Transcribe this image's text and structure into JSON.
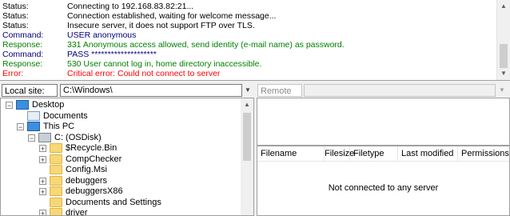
{
  "log": {
    "lines": [
      {
        "type": "Status:",
        "text": "Connecting to 192.168.83.82:21...",
        "color": "#000000"
      },
      {
        "type": "Status:",
        "text": "Connection established, waiting for welcome message...",
        "color": "#000000"
      },
      {
        "type": "Status:",
        "text": "Insecure server, it does not support FTP over TLS.",
        "color": "#000000"
      },
      {
        "type": "Command:",
        "text": "USER anonymous",
        "color": "#000080"
      },
      {
        "type": "Response:",
        "text": "331 Anonymous access allowed, send identity (e-mail name) as password.",
        "color": "#008000"
      },
      {
        "type": "Command:",
        "text": "PASS ********************",
        "color": "#000080"
      },
      {
        "type": "Response:",
        "text": "530 User cannot log in, home directory inaccessible.",
        "color": "#008000"
      },
      {
        "type": "Error:",
        "text": "Critical error: Could not connect to server",
        "color": "#ff0000"
      }
    ]
  },
  "local": {
    "site_label": "Local site:",
    "path": "C:\\Windows\\",
    "tree": [
      {
        "label": "Desktop",
        "icon": "monitor-icon",
        "level": 0,
        "expander": "minus"
      },
      {
        "label": "Documents",
        "icon": "documents-icon",
        "level": 1,
        "expander": ""
      },
      {
        "label": "This PC",
        "icon": "computer-icon",
        "level": 1,
        "expander": "minus"
      },
      {
        "label": "C: (OSDisk)",
        "icon": "drive-icon",
        "level": 2,
        "expander": "minus"
      },
      {
        "label": "$Recycle.Bin",
        "icon": "folder-icon",
        "level": 3,
        "expander": "plus"
      },
      {
        "label": "CompChecker",
        "icon": "folder-icon",
        "level": 3,
        "expander": "plus"
      },
      {
        "label": "Config.Msi",
        "icon": "folder-icon",
        "level": 3,
        "expander": ""
      },
      {
        "label": "debuggers",
        "icon": "folder-icon",
        "level": 3,
        "expander": "plus"
      },
      {
        "label": "debuggersX86",
        "icon": "folder-icon",
        "level": 3,
        "expander": "plus"
      },
      {
        "label": "Documents and Settings",
        "icon": "folder-icon",
        "level": 3,
        "expander": ""
      },
      {
        "label": "driver",
        "icon": "folder-icon",
        "level": 3,
        "expander": "plus"
      }
    ]
  },
  "remote": {
    "site_label": "Remote site:",
    "path": "",
    "columns": [
      "Filename",
      "Filesize",
      "Filetype",
      "Last modified",
      "Permissions"
    ],
    "empty_message": "Not connected to any server"
  }
}
